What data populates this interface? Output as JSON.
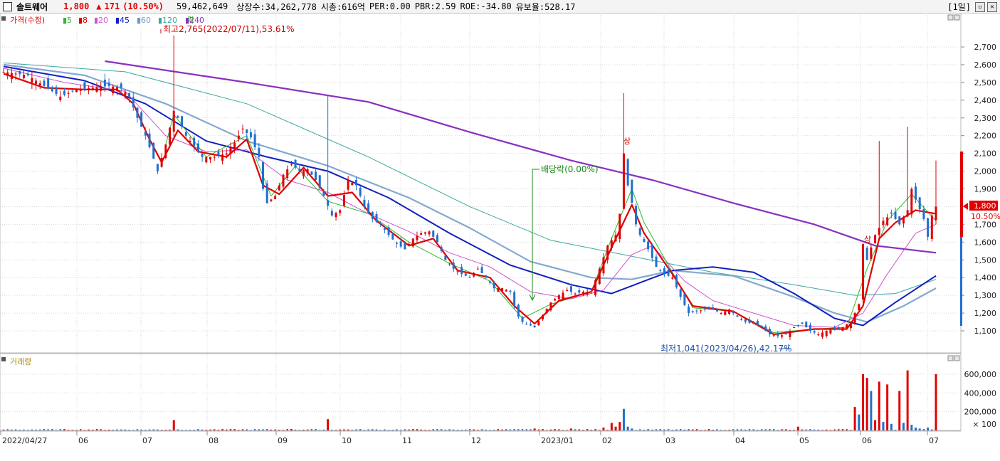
{
  "header": {
    "name": "솔트웨어",
    "price": "1,800",
    "change_arrow": "▲",
    "change": "171",
    "change_pct": "(10.50%)",
    "volume": "59,462,649",
    "listed_shares": "상장수:34,262,778",
    "market_cap": "시총:616억",
    "per": "PER:0.00",
    "pbr": "PBR:2.59",
    "roe": "ROE:-34.80",
    "float_ratio": "유보율:528.17",
    "period": "[1일]"
  },
  "legend": {
    "price_label": "가격(수정)",
    "ma": [
      {
        "label": "5",
        "color": "#2eb82e"
      },
      {
        "label": "8",
        "color": "#e00000"
      },
      {
        "label": "20",
        "color": "#cc55cc"
      },
      {
        "label": "45",
        "color": "#1020c0"
      },
      {
        "label": "60",
        "color": "#6f9ac8"
      },
      {
        "label": "120",
        "color": "#3aa8a0"
      },
      {
        "label": "240",
        "color": "#8a2fc0"
      }
    ],
    "drop_label": "락",
    "volume_label": "거래량"
  },
  "annotations": {
    "high": "최고2,765(2022/07/11),53.61%",
    "low": "최저1,041(2023/04/26),42.17%",
    "dividend": "배당락(0.00%)",
    "up_marker": "상"
  },
  "price_tags": {
    "current": "1,800",
    "pct": "10.50%"
  },
  "colors": {
    "up": "#e00000",
    "down": "#1f6fd0",
    "grid": "#d9d9d9"
  },
  "chart_data": {
    "type": "candlestick",
    "x_ticks": [
      "2022/04/27",
      "06",
      "07",
      "08",
      "09",
      "10",
      "11",
      "12",
      "2023/01",
      "02",
      "03",
      "04",
      "05",
      "06",
      "07"
    ],
    "price_axis": {
      "ticks": [
        1100,
        1200,
        1300,
        1400,
        1500,
        1600,
        1700,
        1800,
        1900,
        2000,
        2100,
        2200,
        2300,
        2400,
        2500,
        2600,
        2700
      ],
      "ylim": [
        1040,
        2760
      ]
    },
    "volume_axis": {
      "ticks": [
        "600,000",
        "400,000",
        "200,000"
      ],
      "unit": "× 100",
      "ylim": [
        0,
        700000
      ]
    },
    "price_close_path": [
      [
        0,
        2560
      ],
      [
        6,
        2540
      ],
      [
        10,
        2480
      ],
      [
        14,
        2420
      ],
      [
        18,
        2460
      ],
      [
        22,
        2470
      ],
      [
        26,
        2480
      ],
      [
        29,
        2470
      ],
      [
        31,
        2420
      ],
      [
        33,
        2300
      ],
      [
        35,
        2200
      ],
      [
        37,
        2070
      ],
      [
        38,
        2000
      ],
      [
        40,
        2150
      ],
      [
        42,
        2340
      ],
      [
        43,
        2300
      ],
      [
        45,
        2200
      ],
      [
        47,
        2140
      ],
      [
        49,
        2080
      ],
      [
        52,
        2080
      ],
      [
        55,
        2100
      ],
      [
        57,
        2160
      ],
      [
        59,
        2240
      ],
      [
        61,
        2190
      ],
      [
        63,
        2080
      ],
      [
        64,
        1900
      ],
      [
        65,
        1820
      ],
      [
        67,
        1860
      ],
      [
        69,
        1980
      ],
      [
        71,
        2040
      ],
      [
        73,
        2000
      ],
      [
        75,
        2010
      ],
      [
        77,
        1950
      ],
      [
        79,
        1860
      ],
      [
        81,
        1750
      ],
      [
        83,
        1780
      ],
      [
        85,
        1950
      ],
      [
        87,
        1920
      ],
      [
        89,
        1800
      ],
      [
        91,
        1730
      ],
      [
        93,
        1700
      ],
      [
        95,
        1640
      ],
      [
        97,
        1590
      ],
      [
        99,
        1560
      ],
      [
        101,
        1620
      ],
      [
        103,
        1650
      ],
      [
        105,
        1660
      ],
      [
        107,
        1600
      ],
      [
        109,
        1500
      ],
      [
        111,
        1450
      ],
      [
        113,
        1420
      ],
      [
        115,
        1400
      ],
      [
        117,
        1450
      ],
      [
        119,
        1400
      ],
      [
        121,
        1340
      ],
      [
        123,
        1340
      ],
      [
        125,
        1320
      ],
      [
        126,
        1240
      ],
      [
        127,
        1180
      ],
      [
        128,
        1150
      ],
      [
        130,
        1130
      ],
      [
        131,
        1120
      ],
      [
        133,
        1190
      ],
      [
        135,
        1260
      ],
      [
        137,
        1300
      ],
      [
        139,
        1330
      ],
      [
        141,
        1310
      ],
      [
        143,
        1320
      ],
      [
        145,
        1320
      ],
      [
        147,
        1450
      ],
      [
        149,
        1580
      ],
      [
        151,
        1640
      ],
      [
        152,
        1760
      ],
      [
        153,
        2100
      ],
      [
        154,
        1920
      ],
      [
        155,
        1820
      ],
      [
        156,
        1700
      ],
      [
        157,
        1640
      ],
      [
        159,
        1560
      ],
      [
        161,
        1460
      ],
      [
        163,
        1420
      ],
      [
        165,
        1400
      ],
      [
        167,
        1290
      ],
      [
        169,
        1200
      ],
      [
        171,
        1210
      ],
      [
        173,
        1220
      ],
      [
        175,
        1220
      ],
      [
        177,
        1200
      ],
      [
        179,
        1220
      ],
      [
        181,
        1180
      ],
      [
        183,
        1150
      ],
      [
        185,
        1140
      ],
      [
        187,
        1120
      ],
      [
        189,
        1080
      ],
      [
        191,
        1070
      ],
      [
        193,
        1080
      ],
      [
        195,
        1120
      ],
      [
        197,
        1140
      ],
      [
        199,
        1100
      ],
      [
        201,
        1080
      ],
      [
        203,
        1100
      ],
      [
        205,
        1110
      ],
      [
        207,
        1120
      ],
      [
        209,
        1150
      ],
      [
        211,
        1250
      ],
      [
        212,
        1590
      ],
      [
        213,
        1500
      ],
      [
        215,
        1640
      ],
      [
        217,
        1720
      ],
      [
        219,
        1760
      ],
      [
        221,
        1700
      ],
      [
        223,
        1780
      ],
      [
        224,
        1900
      ],
      [
        225,
        1840
      ],
      [
        227,
        1730
      ],
      [
        228,
        1630
      ],
      [
        229,
        1750
      ],
      [
        230,
        1800
      ]
    ],
    "ma_paths": {
      "5": [
        [
          40,
          2150
        ],
        [
          42,
          2320
        ],
        [
          45,
          2230
        ],
        [
          50,
          2080
        ],
        [
          60,
          2200
        ],
        [
          66,
          1860
        ],
        [
          72,
          2030
        ],
        [
          80,
          1830
        ],
        [
          90,
          1760
        ],
        [
          100,
          1600
        ],
        [
          110,
          1480
        ],
        [
          120,
          1380
        ],
        [
          128,
          1170
        ],
        [
          135,
          1250
        ],
        [
          145,
          1320
        ],
        [
          150,
          1620
        ],
        [
          155,
          1900
        ],
        [
          158,
          1710
        ],
        [
          165,
          1430
        ],
        [
          170,
          1230
        ],
        [
          180,
          1210
        ],
        [
          190,
          1090
        ],
        [
          200,
          1110
        ],
        [
          208,
          1120
        ],
        [
          213,
          1450
        ],
        [
          218,
          1720
        ],
        [
          224,
          1870
        ],
        [
          230,
          1720
        ]
      ],
      "8": [
        [
          0,
          2550
        ],
        [
          10,
          2470
        ],
        [
          20,
          2460
        ],
        [
          28,
          2460
        ],
        [
          32,
          2380
        ],
        [
          36,
          2180
        ],
        [
          39,
          2050
        ],
        [
          43,
          2230
        ],
        [
          48,
          2110
        ],
        [
          55,
          2080
        ],
        [
          60,
          2180
        ],
        [
          64,
          1920
        ],
        [
          68,
          1870
        ],
        [
          74,
          2020
        ],
        [
          80,
          1860
        ],
        [
          86,
          1880
        ],
        [
          92,
          1720
        ],
        [
          100,
          1580
        ],
        [
          106,
          1620
        ],
        [
          112,
          1440
        ],
        [
          120,
          1400
        ],
        [
          126,
          1240
        ],
        [
          131,
          1140
        ],
        [
          137,
          1270
        ],
        [
          145,
          1320
        ],
        [
          150,
          1570
        ],
        [
          155,
          1810
        ],
        [
          158,
          1650
        ],
        [
          165,
          1420
        ],
        [
          170,
          1240
        ],
        [
          180,
          1210
        ],
        [
          190,
          1080
        ],
        [
          200,
          1110
        ],
        [
          208,
          1110
        ],
        [
          212,
          1240
        ],
        [
          216,
          1620
        ],
        [
          220,
          1710
        ],
        [
          225,
          1780
        ],
        [
          230,
          1760
        ]
      ],
      "20": [
        [
          0,
          2580
        ],
        [
          15,
          2500
        ],
        [
          30,
          2450
        ],
        [
          40,
          2200
        ],
        [
          50,
          2110
        ],
        [
          60,
          2120
        ],
        [
          70,
          1950
        ],
        [
          80,
          1880
        ],
        [
          90,
          1760
        ],
        [
          100,
          1660
        ],
        [
          110,
          1540
        ],
        [
          120,
          1460
        ],
        [
          130,
          1320
        ],
        [
          140,
          1280
        ],
        [
          148,
          1330
        ],
        [
          155,
          1530
        ],
        [
          160,
          1580
        ],
        [
          168,
          1380
        ],
        [
          175,
          1270
        ],
        [
          185,
          1200
        ],
        [
          195,
          1130
        ],
        [
          205,
          1120
        ],
        [
          212,
          1200
        ],
        [
          218,
          1420
        ],
        [
          225,
          1650
        ],
        [
          230,
          1700
        ]
      ],
      "45": [
        [
          0,
          2590
        ],
        [
          20,
          2510
        ],
        [
          35,
          2380
        ],
        [
          50,
          2170
        ],
        [
          65,
          2080
        ],
        [
          80,
          2000
        ],
        [
          95,
          1850
        ],
        [
          110,
          1650
        ],
        [
          125,
          1470
        ],
        [
          140,
          1360
        ],
        [
          150,
          1310
        ],
        [
          158,
          1380
        ],
        [
          165,
          1440
        ],
        [
          175,
          1460
        ],
        [
          185,
          1430
        ],
        [
          195,
          1310
        ],
        [
          205,
          1170
        ],
        [
          212,
          1130
        ],
        [
          220,
          1260
        ],
        [
          230,
          1410
        ]
      ],
      "60": [
        [
          0,
          2600
        ],
        [
          20,
          2540
        ],
        [
          40,
          2380
        ],
        [
          60,
          2170
        ],
        [
          80,
          2030
        ],
        [
          100,
          1850
        ],
        [
          115,
          1680
        ],
        [
          130,
          1490
        ],
        [
          145,
          1400
        ],
        [
          155,
          1390
        ],
        [
          165,
          1440
        ],
        [
          180,
          1410
        ],
        [
          195,
          1290
        ],
        [
          205,
          1200
        ],
        [
          213,
          1150
        ],
        [
          222,
          1240
        ],
        [
          230,
          1340
        ]
      ],
      "120": [
        [
          0,
          2610
        ],
        [
          30,
          2560
        ],
        [
          60,
          2380
        ],
        [
          90,
          2080
        ],
        [
          115,
          1800
        ],
        [
          135,
          1610
        ],
        [
          155,
          1520
        ],
        [
          175,
          1430
        ],
        [
          195,
          1360
        ],
        [
          210,
          1300
        ],
        [
          220,
          1310
        ],
        [
          230,
          1390
        ]
      ],
      "240": [
        [
          25,
          2620
        ],
        [
          60,
          2500
        ],
        [
          90,
          2390
        ],
        [
          115,
          2220
        ],
        [
          140,
          2060
        ],
        [
          160,
          1950
        ],
        [
          180,
          1820
        ],
        [
          200,
          1700
        ],
        [
          215,
          1580
        ],
        [
          230,
          1540
        ]
      ]
    },
    "volume_bars": [
      {
        "i": 42,
        "v": 110000,
        "up": true
      },
      {
        "i": 71,
        "v": 15000,
        "up": true
      },
      {
        "i": 80,
        "v": 120000,
        "up": true
      },
      {
        "i": 131,
        "v": 20000,
        "up": true
      },
      {
        "i": 140,
        "v": 20000,
        "up": true
      },
      {
        "i": 148,
        "v": 30000,
        "up": true
      },
      {
        "i": 150,
        "v": 80000,
        "up": true
      },
      {
        "i": 151,
        "v": 40000,
        "up": true
      },
      {
        "i": 152,
        "v": 90000,
        "up": true
      },
      {
        "i": 153,
        "v": 230000,
        "up": false
      },
      {
        "i": 154,
        "v": 40000,
        "up": false
      },
      {
        "i": 155,
        "v": 20000,
        "up": false
      },
      {
        "i": 196,
        "v": 40000,
        "up": true
      },
      {
        "i": 210,
        "v": 250000,
        "up": true
      },
      {
        "i": 211,
        "v": 170000,
        "up": false
      },
      {
        "i": 212,
        "v": 600000,
        "up": true
      },
      {
        "i": 213,
        "v": 560000,
        "up": true
      },
      {
        "i": 214,
        "v": 420000,
        "up": false
      },
      {
        "i": 215,
        "v": 110000,
        "up": true
      },
      {
        "i": 216,
        "v": 520000,
        "up": true
      },
      {
        "i": 217,
        "v": 90000,
        "up": false
      },
      {
        "i": 218,
        "v": 490000,
        "up": true
      },
      {
        "i": 219,
        "v": 70000,
        "up": false
      },
      {
        "i": 221,
        "v": 420000,
        "up": true
      },
      {
        "i": 222,
        "v": 80000,
        "up": false
      },
      {
        "i": 223,
        "v": 640000,
        "up": true
      },
      {
        "i": 224,
        "v": 60000,
        "up": false
      },
      {
        "i": 225,
        "v": 30000,
        "up": false
      },
      {
        "i": 226,
        "v": 20000,
        "up": false
      },
      {
        "i": 228,
        "v": 30000,
        "up": false
      },
      {
        "i": 230,
        "v": 600000,
        "up": true
      }
    ]
  }
}
